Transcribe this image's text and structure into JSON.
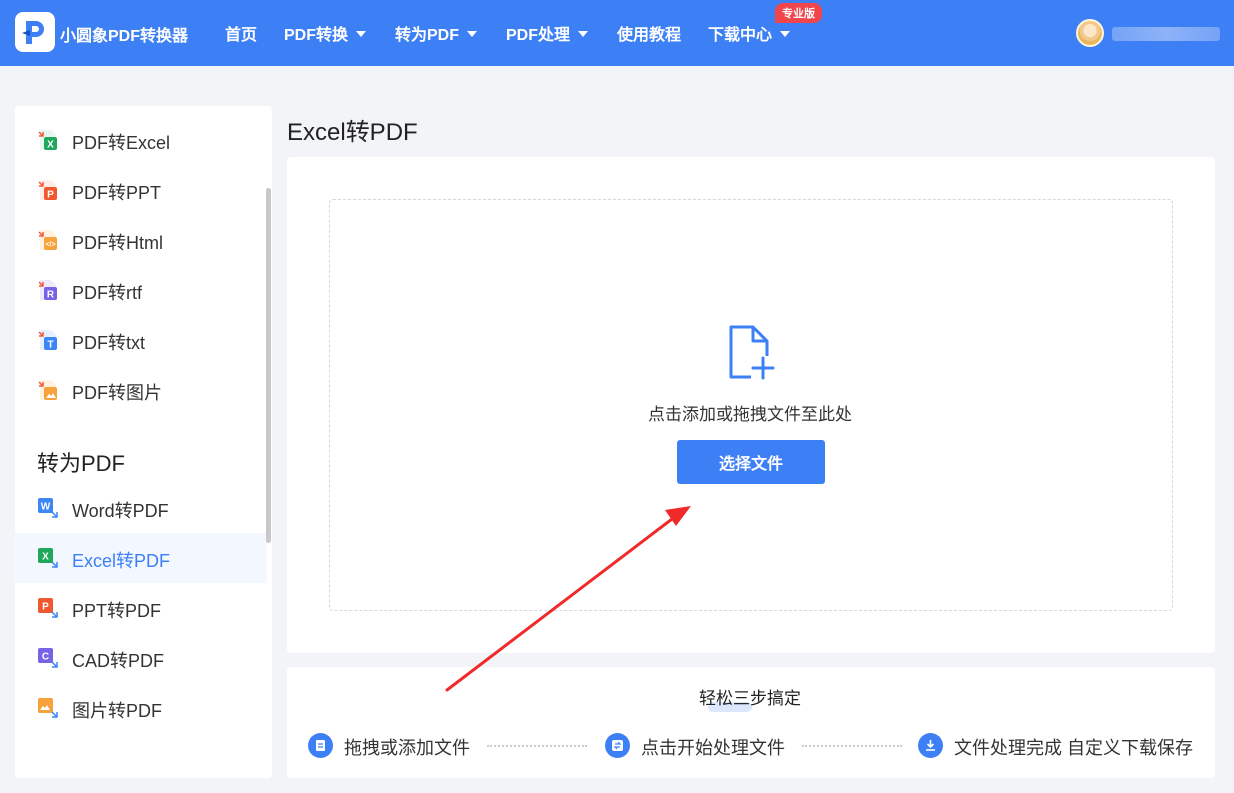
{
  "header": {
    "brand": "小圆象PDF转换器",
    "nav": [
      {
        "label": "首页",
        "has_caret": false
      },
      {
        "label": "PDF转换",
        "has_caret": true
      },
      {
        "label": "转为PDF",
        "has_caret": true
      },
      {
        "label": "PDF处理",
        "has_caret": true
      },
      {
        "label": "使用教程",
        "has_caret": false
      },
      {
        "label": "下载中心",
        "has_caret": true
      }
    ],
    "pro_badge": "专业版",
    "accent_color": "#3d7ff5"
  },
  "sidebar": {
    "pdf_to_items": [
      {
        "label": "PDF转Excel",
        "icon": "excel-file-icon"
      },
      {
        "label": "PDF转PPT",
        "icon": "ppt-file-icon"
      },
      {
        "label": "PDF转Html",
        "icon": "html-file-icon"
      },
      {
        "label": "PDF转rtf",
        "icon": "rtf-file-icon"
      },
      {
        "label": "PDF转txt",
        "icon": "txt-file-icon"
      },
      {
        "label": "PDF转图片",
        "icon": "image-file-icon"
      }
    ],
    "to_pdf_heading": "转为PDF",
    "to_pdf_items": [
      {
        "label": "Word转PDF",
        "icon": "word-file-icon"
      },
      {
        "label": "Excel转PDF",
        "icon": "excel-file-icon",
        "active": true
      },
      {
        "label": "PPT转PDF",
        "icon": "ppt-file-icon"
      },
      {
        "label": "CAD转PDF",
        "icon": "cad-file-icon"
      },
      {
        "label": "图片转PDF",
        "icon": "image-file-icon"
      }
    ]
  },
  "main": {
    "title": "Excel转PDF",
    "drop_hint": "点击添加或拖拽文件至此处",
    "choose_button": "选择文件",
    "steps_title": "轻松三步搞定",
    "steps": [
      {
        "label": "拖拽或添加文件",
        "icon": "document-icon"
      },
      {
        "label": "点击开始处理文件",
        "icon": "convert-icon"
      },
      {
        "label": "文件处理完成 自定义下载保存",
        "icon": "download-icon"
      }
    ]
  }
}
